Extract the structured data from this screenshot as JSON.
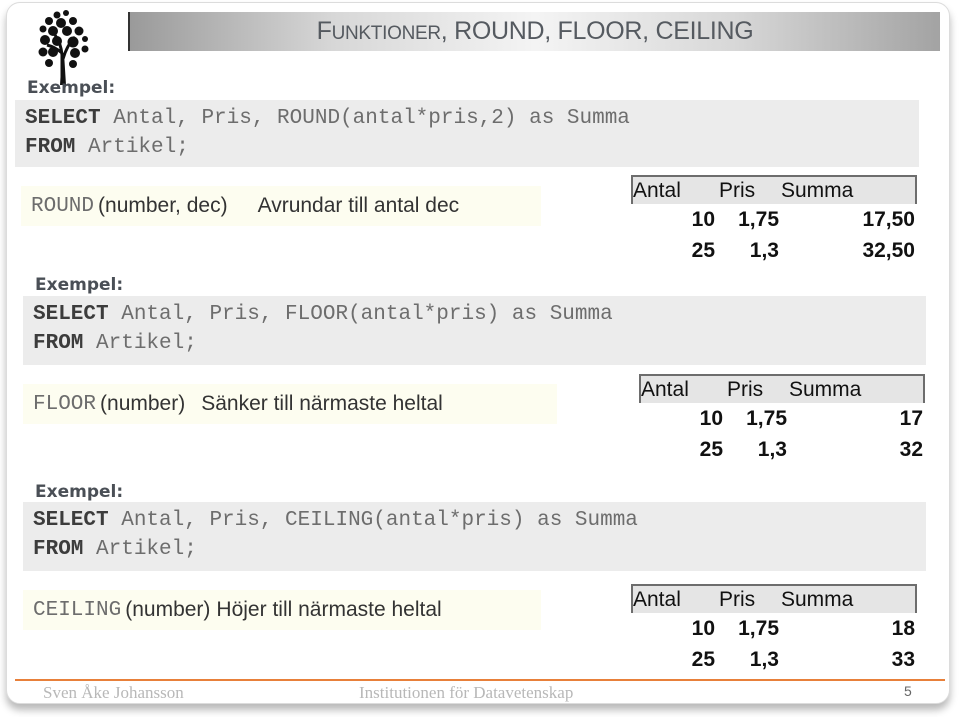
{
  "title": {
    "first_letter": "F",
    "rest_smallcaps": "UNKTIONER",
    "tail": ", ROUND, FLOOR, CEILING"
  },
  "sections": [
    {
      "example_label": "Exempel:",
      "code": {
        "line1_kw": "SELECT",
        "line1_rest": " Antal, Pris, ROUND(antal*pris,2) as Summa",
        "line2_kw": "FROM",
        "line2_rest": " Artikel;"
      },
      "desc": {
        "fn": "ROUND",
        "args": "(number, dec)",
        "text": "Avrundar till antal dec"
      },
      "result": {
        "headers": [
          "Antal",
          "Pris",
          "Summa"
        ],
        "rows": [
          [
            "10",
            "1,75",
            "17,50"
          ],
          [
            "25",
            "1,3",
            "32,50"
          ]
        ]
      }
    },
    {
      "example_label": "Exempel:",
      "code": {
        "line1_kw": "SELECT",
        "line1_rest": " Antal, Pris, FLOOR(antal*pris) as Summa",
        "line2_kw": "FROM",
        "line2_rest": " Artikel;"
      },
      "desc": {
        "fn": "FLOOR",
        "args": "(number)",
        "text": "Sänker till närmaste heltal"
      },
      "result": {
        "headers": [
          "Antal",
          "Pris",
          "Summa"
        ],
        "rows": [
          [
            "10",
            "1,75",
            "17"
          ],
          [
            "25",
            "1,3",
            "32"
          ]
        ]
      }
    },
    {
      "example_label": "Exempel:",
      "code": {
        "line1_kw": "SELECT",
        "line1_rest": " Antal, Pris, CEILING(antal*pris) as Summa",
        "line2_kw": "FROM",
        "line2_rest": " Artikel;"
      },
      "desc": {
        "fn": "CEILING",
        "args": "(number)",
        "text": "Höjer till närmaste heltal"
      },
      "result": {
        "headers": [
          "Antal",
          "Pris",
          "Summa"
        ],
        "rows": [
          [
            "10",
            "1,75",
            "18"
          ],
          [
            "25",
            "1,3",
            "33"
          ]
        ]
      }
    }
  ],
  "footer": {
    "author": "Sven Åke Johansson",
    "department": "Institutionen för Datavetenskap",
    "page": "5"
  },
  "colors": {
    "footer_line": "#e8803a",
    "code_bg": "#ececec",
    "desc_bg": "#fdfdf0"
  }
}
